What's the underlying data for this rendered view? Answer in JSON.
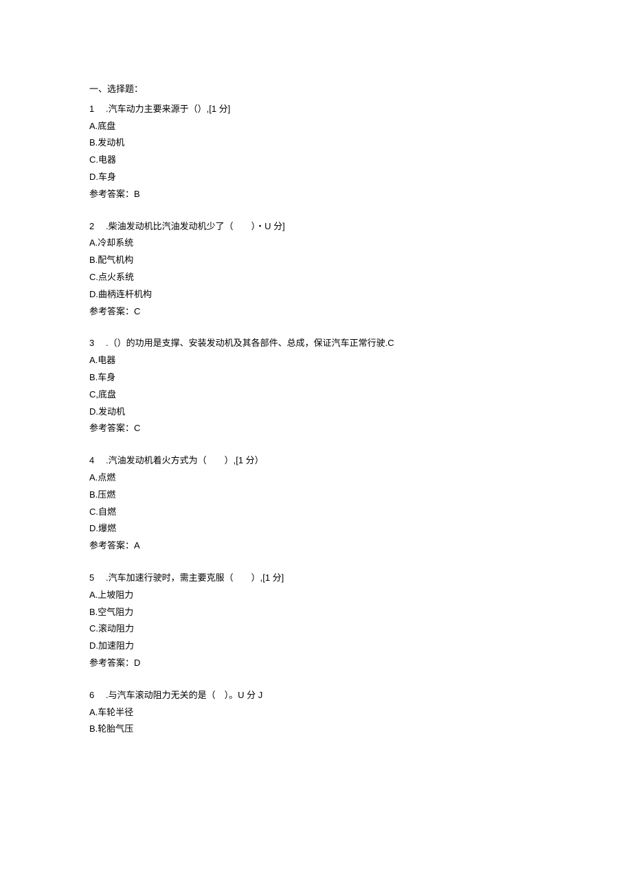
{
  "section_title": "一、选择题：",
  "questions": [
    {
      "num": "1",
      "stem": ".汽车动力主要来源于（）,[1 分]",
      "options": [
        "A.底盘",
        "B.发动机",
        "C.电器",
        "D.车身"
      ],
      "answer": "参考答案：B"
    },
    {
      "num": "2",
      "stem": ".柴油发动机比汽油发动机少了（　　）・U 分]",
      "options": [
        "A.冷却系统",
        "B.配气机构",
        "C.点火系统",
        "D.曲柄连杆机构"
      ],
      "answer": "参考答案：C"
    },
    {
      "num": "3",
      "stem": ".（）的功用是支撑、安装发动机及其各部件、总成，保证汽车正常行驶.C",
      "options": [
        "A.电器",
        "B.车身",
        "C,底盘",
        "D.发动机"
      ],
      "answer": "参考答案：C"
    },
    {
      "num": "4",
      "stem": ".汽油发动机着火方式为（　　）,[1 分）",
      "options": [
        "A.点燃",
        "B.压燃",
        "C.自燃",
        "D.爆燃"
      ],
      "answer": "参考答案：A"
    },
    {
      "num": "5",
      "stem": ".汽车加速行驶时，需主要克服（　　）,[1 分]",
      "options": [
        "A.上坡阻力",
        "B.空气阻力",
        "C.滚动阻力",
        "D.加速阻力"
      ],
      "answer": "参考答案：D"
    },
    {
      "num": "6",
      "stem": ".与汽车滚动阻力无关的是（　）。U 分 J",
      "options": [
        "A.车轮半径",
        "B.轮胎气压"
      ],
      "answer": ""
    }
  ]
}
